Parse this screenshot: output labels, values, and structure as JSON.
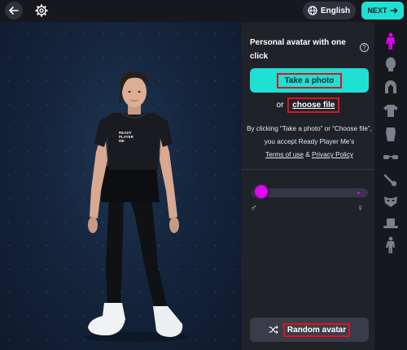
{
  "header": {
    "language": "English",
    "next_label": "NEXT"
  },
  "panel": {
    "title": "Personal avatar with one click",
    "help": "?",
    "take_photo": "Take a photo",
    "or": "or",
    "choose_file": "choose file",
    "consent_text": "By clicking “Take a photo” or “Choose file”, you accept Ready Player Me’s",
    "terms": "Terms of use",
    "amp": "&",
    "privacy": "Privacy Policy",
    "gender_slider_level": 0.0,
    "random_avatar": "Random avatar"
  },
  "avatar": {
    "shirt_text": "READY PLAYER ME"
  },
  "sidebar": {
    "items": [
      "full-body-icon",
      "head-icon",
      "hair-icon",
      "shirt-icon",
      "glasses-icon",
      "beard-icon",
      "mask-icon",
      "hat-icon",
      "pose-icon"
    ],
    "active_index": 0
  },
  "colors": {
    "accent": "#1ee0d3",
    "highlight": "#e600ff",
    "annotation_box": "#e0121f"
  }
}
